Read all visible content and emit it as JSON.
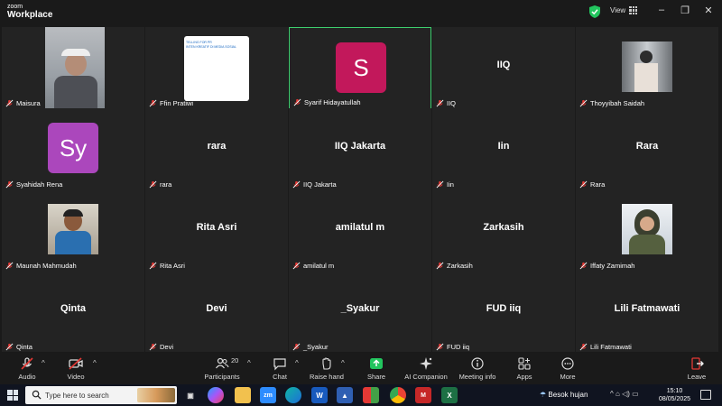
{
  "app": {
    "brand_line1": "zoom",
    "brand_line2": "Workplace",
    "view_label": "View"
  },
  "tiles": [
    {
      "name": "Maisura"
    },
    {
      "name": "Ffin Pratiwi",
      "share_text": "TELLING FOR PR\nINTEN KREATIF DI MEDIA SOSIAL"
    },
    {
      "name": "Syarif Hidayatullah",
      "avatar_letter": "S",
      "avatar_color": "#c2185b"
    },
    {
      "name": "IIQ",
      "big": "IIQ"
    },
    {
      "name": "Thoyyibah Saidah"
    },
    {
      "name": "Syahidah Rena",
      "avatar_letter": "Sy",
      "avatar_color": "#ab47bc"
    },
    {
      "name": "rara",
      "big": "rara"
    },
    {
      "name": "IIQ Jakarta",
      "big": "IIQ Jakarta"
    },
    {
      "name": "Iin",
      "big": "Iin"
    },
    {
      "name": "Rara",
      "big": "Rara"
    },
    {
      "name": "Maunah Mahmudah"
    },
    {
      "name": "Rita Asri",
      "big": "Rita Asri"
    },
    {
      "name": "amilatul m",
      "big": "amilatul m"
    },
    {
      "name": "Zarkasih",
      "big": "Zarkasih"
    },
    {
      "name": "Iffaty Zamimah"
    },
    {
      "name": "Qinta",
      "big": "Qinta"
    },
    {
      "name": "Devi",
      "big": "Devi"
    },
    {
      "name": "_Syakur",
      "big": "_Syakur"
    },
    {
      "name": "FUD iiq",
      "big": "FUD iiq"
    },
    {
      "name": "Lili Fatmawati",
      "big": "Lili Fatmawati"
    }
  ],
  "controls": {
    "audio": "Audio",
    "video": "Video",
    "participants": "Participants",
    "participants_count": "20",
    "chat": "Chat",
    "raise_hand": "Raise hand",
    "share": "Share",
    "ai_companion": "AI Companion",
    "meeting_info": "Meeting info",
    "apps": "Apps",
    "more": "More",
    "leave": "Leave"
  },
  "taskbar": {
    "search_placeholder": "Type here to search",
    "weather": "Besok hujan",
    "time": "15:10",
    "date": "08/05/2025"
  },
  "colors": {
    "active_border": "#3ecf6e",
    "leave": "#e53935",
    "share": "#22c55e"
  }
}
